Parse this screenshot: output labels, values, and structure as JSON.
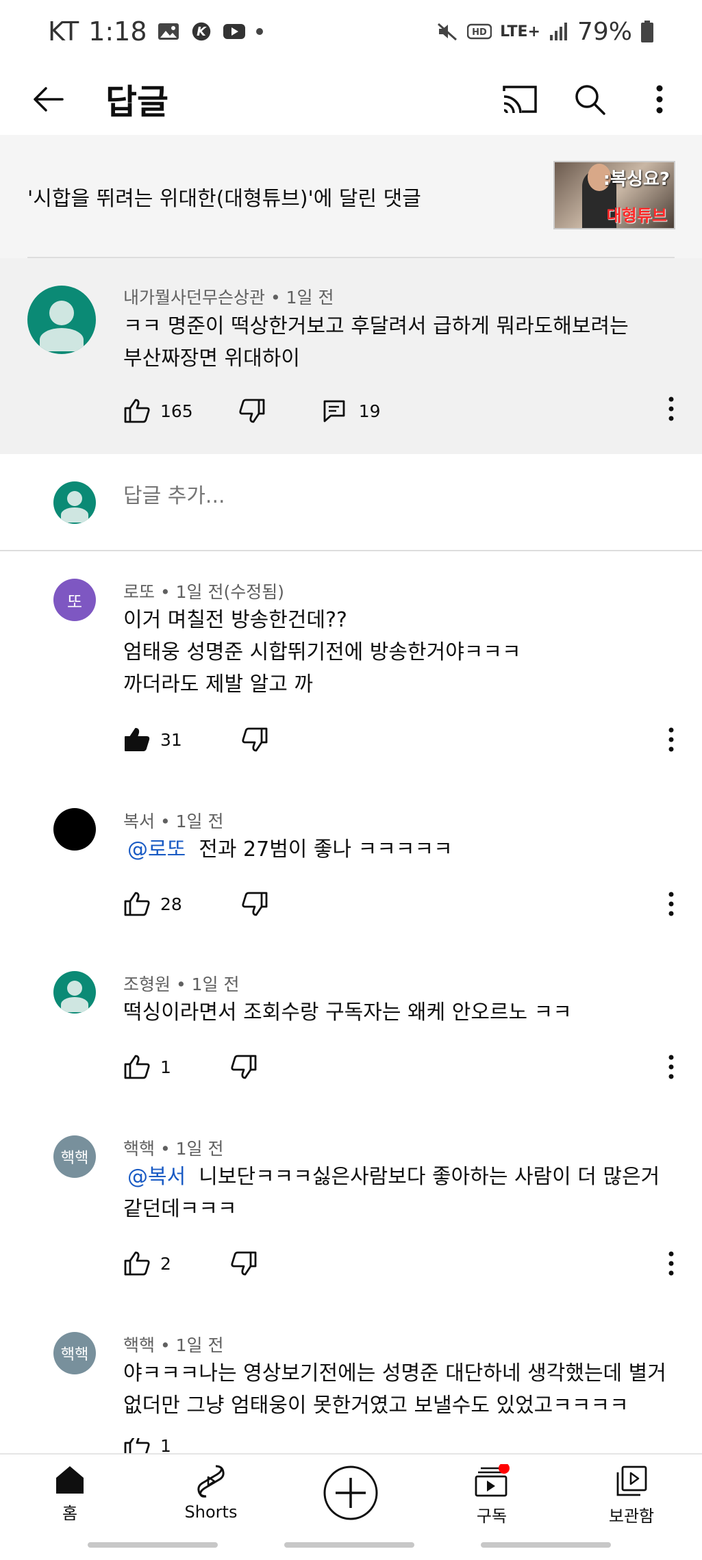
{
  "status_bar": {
    "carrier": "KT",
    "time": "1:18",
    "network": "LTE+",
    "battery": "79%"
  },
  "app_bar": {
    "title": "답글"
  },
  "video_ref": {
    "text": "'시합을 뛰려는 위대한(대형튜브)'에 달린 댓글",
    "thumb_text_top": ":복싱요?",
    "thumb_text_bottom": "대형튜브"
  },
  "parent_comment": {
    "author": "내가뭘사던무슨상관",
    "time": "1일 전",
    "line1": "ㅋㅋ 명준이 떡상한거보고 후달려서 급하게 뭐라도해보려는",
    "line2": "부산짜장면 위대하이",
    "likes": "165",
    "replies": "19"
  },
  "add_reply": {
    "placeholder": "답글 추가..."
  },
  "replies": [
    {
      "avatar_text": "또",
      "author": "로또",
      "time": "1일 전(수정됨)",
      "line1": "이거 며칠전 방송한건데??",
      "line2": "엄태웅 성명준 시합뛰기전에 방송한거야ㅋㅋㅋ",
      "line3": "까더라도 제발 알고 까",
      "likes": "31"
    },
    {
      "author": "복서",
      "time": "1일 전",
      "mention": "@로또",
      "line1": "전과 27범이 좋나 ㅋㅋㅋㅋㅋ",
      "likes": "28"
    },
    {
      "author": "조형원",
      "time": "1일 전",
      "line1": "떡싱이라면서 조회수랑 구독자는 왜케 안오르노 ㅋㅋ",
      "likes": "1"
    },
    {
      "avatar_text": "핵핵",
      "author": "핵핵",
      "time": "1일 전",
      "mention": "@복서",
      "line1": "니보단ㅋㅋㅋ싫은사람보다 좋아하는 사람이 더 많은거",
      "line2": "같던데ㅋㅋㅋ",
      "likes": "2"
    },
    {
      "avatar_text": "핵핵",
      "author": "핵핵",
      "time": "1일 전",
      "line1": "야ㅋㅋㅋ나는 영상보기전에는 성명준 대단하네 생각했는데 별거",
      "line2": "없더만 그냥 엄태웅이 못한거였고 보낼수도 있었고ㅋㅋㅋㅋ",
      "likes": "1"
    }
  ],
  "bottom_nav": {
    "home": "홈",
    "shorts": "Shorts",
    "subscriptions": "구독",
    "library": "보관함"
  },
  "colors": {
    "accent_blue": "#1a5bc4",
    "avatar_teal": "#0b8a75",
    "avatar_purple": "#7e57c2",
    "avatar_gray": "#78909c",
    "notification_red": "#ff0000"
  }
}
